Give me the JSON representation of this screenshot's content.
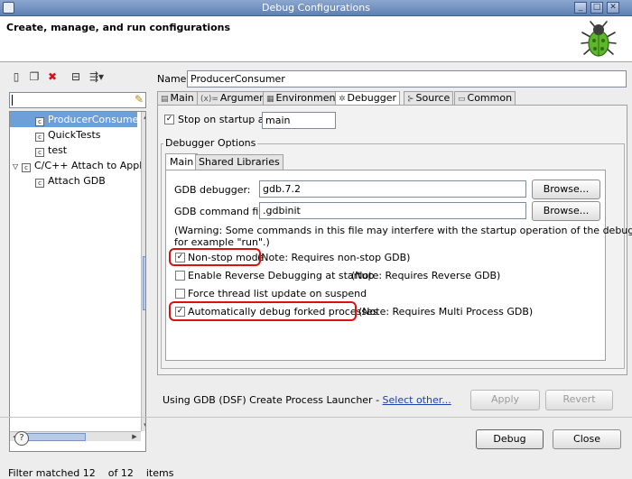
{
  "window": {
    "title": "Debug Configurations",
    "controls": {
      "minimize": "_",
      "maximize": "□",
      "close": "✕"
    }
  },
  "header": {
    "heading": "Create, manage, and run configurations",
    "logo_icon": "bug-icon"
  },
  "left_toolbar": {
    "buttons": [
      {
        "name": "new-launch-configuration-button",
        "icon": "new-config-icon",
        "glyph": "▯"
      },
      {
        "name": "duplicate-button",
        "icon": "duplicate-icon",
        "glyph": "❐"
      },
      {
        "name": "delete-button",
        "icon": "delete-icon",
        "glyph": "✖",
        "color": "#d0121a"
      },
      {
        "name": "collapse-all-button",
        "icon": "collapse-all-icon",
        "glyph": "⊟"
      },
      {
        "name": "filter-button",
        "icon": "filter-icon",
        "glyph": "⇶▾"
      }
    ]
  },
  "filter": {
    "value": ""
  },
  "tree": {
    "items": [
      {
        "label": "ProducerConsumer",
        "selected": true,
        "indent": 1
      },
      {
        "label": "QuickTests",
        "selected": false,
        "indent": 1
      },
      {
        "label": "test",
        "selected": false,
        "indent": 1
      },
      {
        "label": "C/C++ Attach to Applic",
        "selected": false,
        "indent": 0,
        "expanded": true
      },
      {
        "label": "Attach GDB",
        "selected": false,
        "indent": 1
      }
    ],
    "status": "Filter matched 12    of 12    items"
  },
  "name_field": {
    "label": "Name:",
    "value": "ProducerConsumer"
  },
  "tabs": [
    {
      "label": "Main",
      "icon": "main-tab-icon",
      "glyph": "▤",
      "active": false
    },
    {
      "label": "Arguments",
      "icon": "arguments-tab-icon",
      "glyph": "(x)=",
      "active": false
    },
    {
      "label": "Environment",
      "icon": "environment-tab-icon",
      "glyph": "▦",
      "active": false
    },
    {
      "label": "Debugger",
      "icon": "debugger-tab-icon",
      "glyph": "✲",
      "active": true
    },
    {
      "label": "Source",
      "icon": "source-tab-icon",
      "glyph": "⊱",
      "active": false
    },
    {
      "label": "Common",
      "icon": "common-tab-icon",
      "glyph": "▭",
      "active": false
    }
  ],
  "debugger": {
    "stop_on_startup": {
      "label": "Stop on startup at:",
      "checked": true,
      "value": "main"
    },
    "options_group_label": "Debugger Options",
    "inner_tabs": [
      {
        "label": "Main",
        "active": true
      },
      {
        "label": "Shared Libraries",
        "active": false
      }
    ],
    "gdb_debugger": {
      "label": "GDB debugger:",
      "value": "gdb.7.2",
      "browse": "Browse..."
    },
    "gdb_command_file": {
      "label": "GDB command file:",
      "value": ".gdbinit",
      "browse": "Browse..."
    },
    "warning_line1": "(Warning: Some commands in this file may interfere with the startup operation of the debugger,",
    "warning_line2": "for example \"run\".)",
    "options": [
      {
        "label": "Non-stop mode",
        "note": "(Note: Requires non-stop GDB)",
        "checked": true,
        "highlighted": true
      },
      {
        "label": "Enable Reverse Debugging at startup",
        "note": "(Note: Requires Reverse GDB)",
        "checked": false,
        "highlighted": false
      },
      {
        "label": "Force thread list update on suspend",
        "note": "",
        "checked": false,
        "highlighted": false
      },
      {
        "label": "Automatically debug forked processes",
        "note": "(Note: Requires Multi Process GDB)",
        "checked": true,
        "highlighted": true
      }
    ],
    "highlight_color": "#d71212"
  },
  "launcher": {
    "text": "Using GDB (DSF) Create Process Launcher - ",
    "link": "Select other..."
  },
  "buttons": {
    "apply": "Apply",
    "revert": "Revert",
    "debug": "Debug",
    "close": "Close",
    "help": "?"
  },
  "colors": {
    "selection": "#6e9fd8",
    "titlebar": "#6f8ec0",
    "link": "#1a3fb0"
  }
}
